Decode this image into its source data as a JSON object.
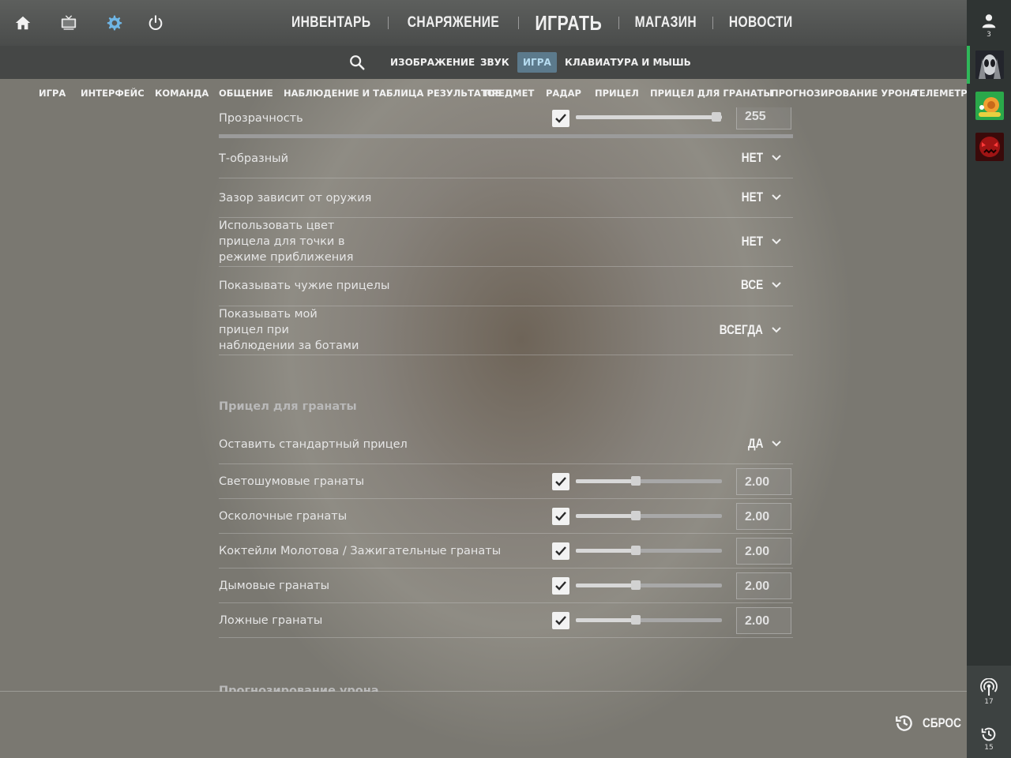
{
  "top_nav": {
    "items": [
      "ИНВЕНТАРЬ",
      "СНАРЯЖЕНИЕ",
      "ИГРАТЬ",
      "МАГАЗИН",
      "НОВОСТИ"
    ],
    "left_icons": [
      "home-icon",
      "tv-icon",
      "gear-icon",
      "power-icon"
    ]
  },
  "sub_nav": {
    "tabs": [
      "ИЗОБРАЖЕНИЕ",
      "ЗВУК",
      "ИГРА",
      "КЛАВИАТУРА И МЫШЬ"
    ],
    "active": "ИГРА"
  },
  "categories": [
    "ИГРА",
    "ИНТЕРФЕЙС",
    "КОМАНДА",
    "ОБЩЕНИЕ",
    "НАБЛЮДЕНИЕ И ТАБЛИЦА РЕЗУЛЬТАТОВ",
    "ПРЕДМЕТ",
    "РАДАР",
    "ПРИЦЕЛ",
    "ПРИЦЕЛ ДЛЯ ГРАНАТЫ",
    "ПРОГНОЗИРОВАНИЕ УРОНА",
    "ТЕЛЕМЕТРИЯ"
  ],
  "crosshair": {
    "opacity": {
      "label": "Прозрачность",
      "value": "255",
      "checked": true,
      "level": 1.0
    },
    "rows": [
      {
        "label": "Т-образный",
        "value": "НЕТ"
      },
      {
        "label": "Зазор зависит от оружия",
        "value": "НЕТ"
      },
      {
        "label": "Использовать цвет\nприцела для точки в\nрежиме приближения",
        "value": "НЕТ"
      },
      {
        "label": "Показывать чужие прицелы",
        "value": "ВСЕ"
      },
      {
        "label": "Показывать мой\nприцел при\nнаблюдении за ботами",
        "value": "ВСЕГДА"
      }
    ]
  },
  "grenade": {
    "section_title": "Прицел для гранаты",
    "keep_default": {
      "label": "Оставить стандартный прицел",
      "value": "ДА"
    },
    "rows": [
      {
        "label": "Светошумовые гранаты",
        "value": "2.00",
        "checked": true,
        "level": 0.41
      },
      {
        "label": "Осколочные гранаты",
        "value": "2.00",
        "checked": true,
        "level": 0.41
      },
      {
        "label": "Коктейли Молотова / Зажигательные гранаты",
        "value": "2.00",
        "checked": true,
        "level": 0.41
      },
      {
        "label": "Дымовые гранаты",
        "value": "2.00",
        "checked": true,
        "level": 0.41
      },
      {
        "label": "Ложные гранаты",
        "value": "2.00",
        "checked": true,
        "level": 0.41
      }
    ]
  },
  "next_section_title": "Прогнозирование урона",
  "reset": {
    "label": "СБРОС"
  },
  "sidebar": {
    "friends_count": "3",
    "broadcast_count": "17",
    "history_count": "15"
  },
  "colors": {
    "active_tab_bg": "#5c7a8c",
    "active_tab_text": "#b6dcf0",
    "gear_icon": "#6fb6e6",
    "sidebar_bg": "#2f3433",
    "online_indicator": "#2fb85a"
  }
}
